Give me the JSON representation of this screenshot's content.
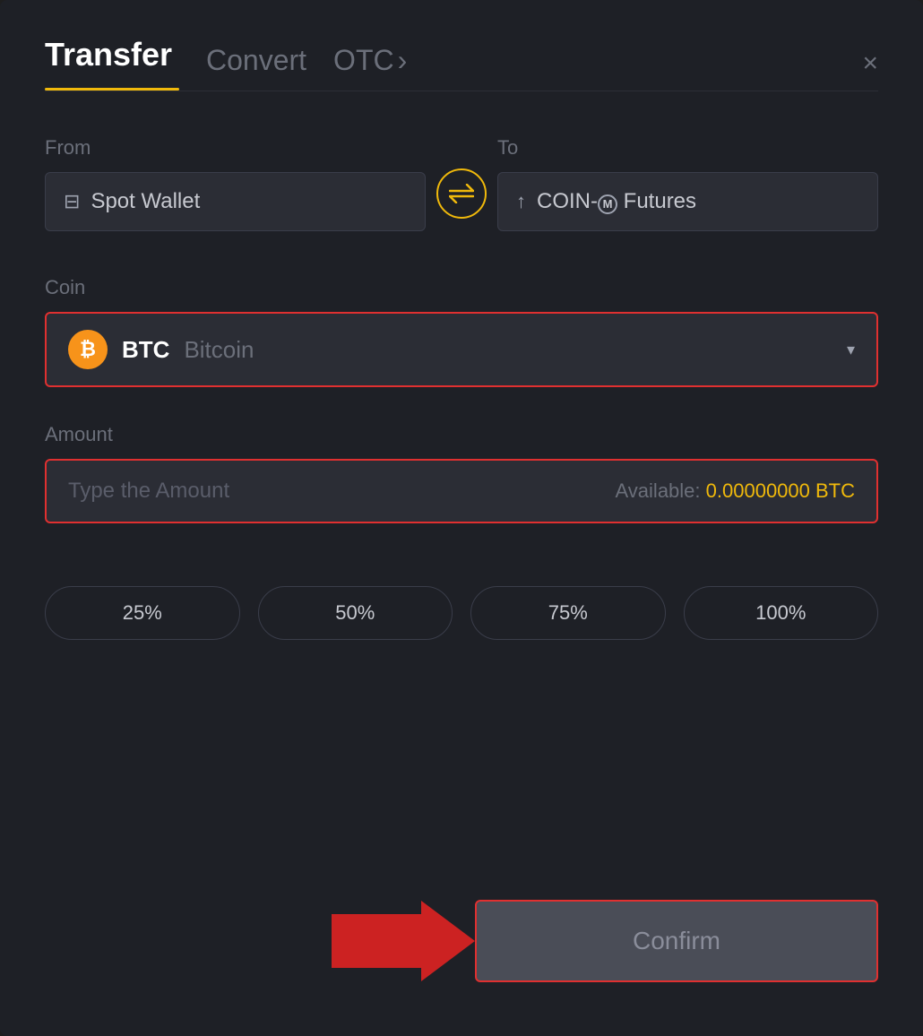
{
  "header": {
    "tab_transfer": "Transfer",
    "tab_convert": "Convert",
    "tab_otc": "OTC",
    "tab_otc_chevron": "›",
    "close_label": "×"
  },
  "from_section": {
    "label": "From",
    "wallet_icon": "▬",
    "wallet_name": "Spot Wallet"
  },
  "to_section": {
    "label": "To",
    "wallet_icon": "↑",
    "wallet_name": "COIN-M Futures",
    "coin_m_symbol": "Ⓜ"
  },
  "coin_section": {
    "label": "Coin",
    "coin_ticker": "BTC",
    "coin_full": "Bitcoin",
    "chevron": "▾"
  },
  "amount_section": {
    "label": "Amount",
    "placeholder": "Type the Amount",
    "available_label": "Available:",
    "available_value": "0.00000000 BTC"
  },
  "percent_buttons": [
    "25%",
    "50%",
    "75%",
    "100%"
  ],
  "confirm_button": {
    "label": "Confirm"
  }
}
